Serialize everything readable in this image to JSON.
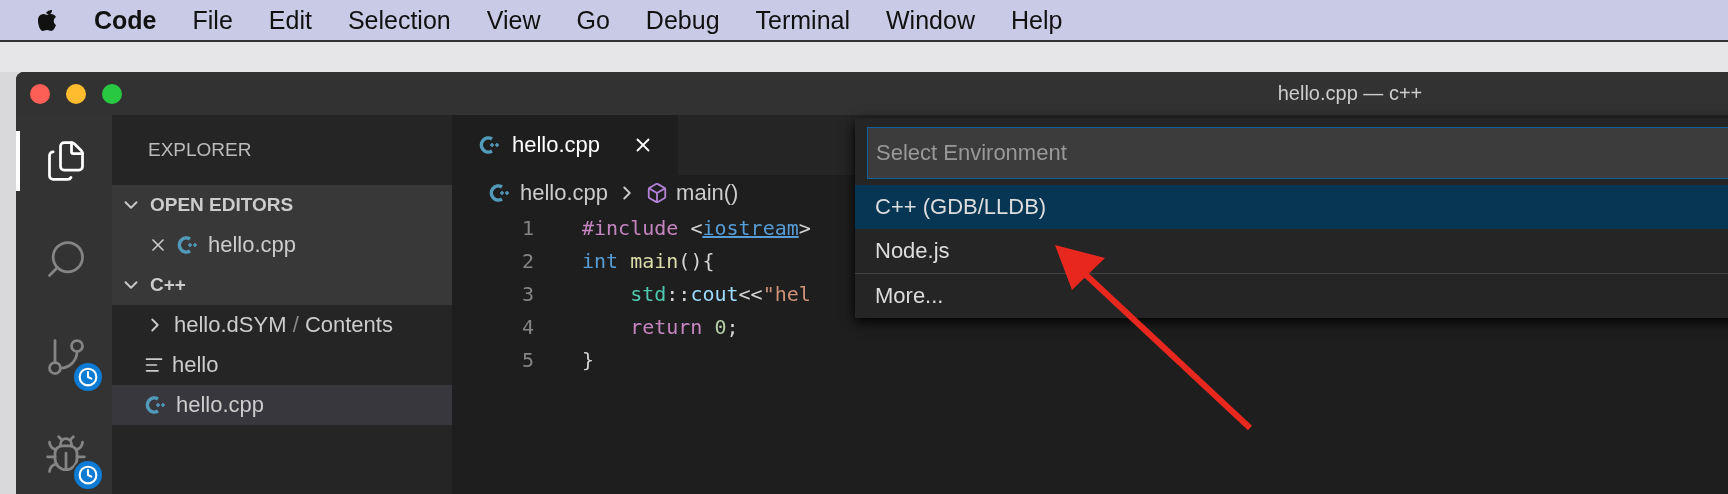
{
  "menubar": {
    "app_name": "Code",
    "items": [
      "File",
      "Edit",
      "Selection",
      "View",
      "Go",
      "Debug",
      "Terminal",
      "Window",
      "Help"
    ]
  },
  "window": {
    "title": "hello.cpp — c++"
  },
  "activity_bar": [
    {
      "kind": "files",
      "selected": true,
      "badge": false
    },
    {
      "kind": "search",
      "selected": false,
      "badge": false
    },
    {
      "kind": "source-control",
      "selected": false,
      "badge": true
    },
    {
      "kind": "debug",
      "selected": false,
      "badge": true
    }
  ],
  "sidebar": {
    "title": "EXPLORER",
    "sections": [
      {
        "title": "OPEN EDITORS",
        "expanded": true,
        "items": [
          {
            "kind": "open-editor",
            "label": "hello.cpp",
            "selected": false
          }
        ]
      },
      {
        "title": "C++",
        "expanded": true,
        "items": [
          {
            "kind": "folder",
            "label": "hello.dSYM",
            "separator": "/",
            "suffix": "Contents",
            "selected": false
          },
          {
            "kind": "text-file",
            "label": "hello",
            "selected": false
          },
          {
            "kind": "cpp-file",
            "label": "hello.cpp",
            "selected": true
          }
        ]
      }
    ]
  },
  "tabs": [
    {
      "label": "hello.cpp",
      "selected": true
    }
  ],
  "breadcrumb": {
    "file": "hello.cpp",
    "symbol": "main()"
  },
  "code_lines": [
    {
      "number": "1",
      "tokens": [
        {
          "kind": "keyword",
          "text": "#include "
        },
        {
          "kind": "punct",
          "text": "<"
        },
        {
          "kind": "link",
          "text": "iostream"
        },
        {
          "kind": "punct",
          "text": ">"
        }
      ]
    },
    {
      "number": "2",
      "tokens": [
        {
          "kind": "type",
          "text": "int "
        },
        {
          "kind": "func",
          "text": "main"
        },
        {
          "kind": "punct",
          "text": "(){"
        }
      ]
    },
    {
      "number": "3",
      "tokens": [
        {
          "kind": "ns",
          "text": "    std"
        },
        {
          "kind": "punct",
          "text": "::"
        },
        {
          "kind": "var",
          "text": "cout"
        },
        {
          "kind": "punct",
          "text": "<<"
        },
        {
          "kind": "string",
          "text": "\"hel"
        }
      ]
    },
    {
      "number": "4",
      "tokens": [
        {
          "kind": "keyword",
          "text": "    return "
        },
        {
          "kind": "number",
          "text": "0"
        },
        {
          "kind": "punct",
          "text": ";"
        }
      ]
    },
    {
      "number": "5",
      "tokens": [
        {
          "kind": "punct",
          "text": "}"
        }
      ]
    }
  ],
  "quick_pick": {
    "placeholder": "Select Environment",
    "items": [
      {
        "label": "C++ (GDB/LLDB)",
        "selected": true
      },
      {
        "label": "Node.js",
        "selected": false
      },
      {
        "label": "More...",
        "selected": false
      }
    ]
  }
}
